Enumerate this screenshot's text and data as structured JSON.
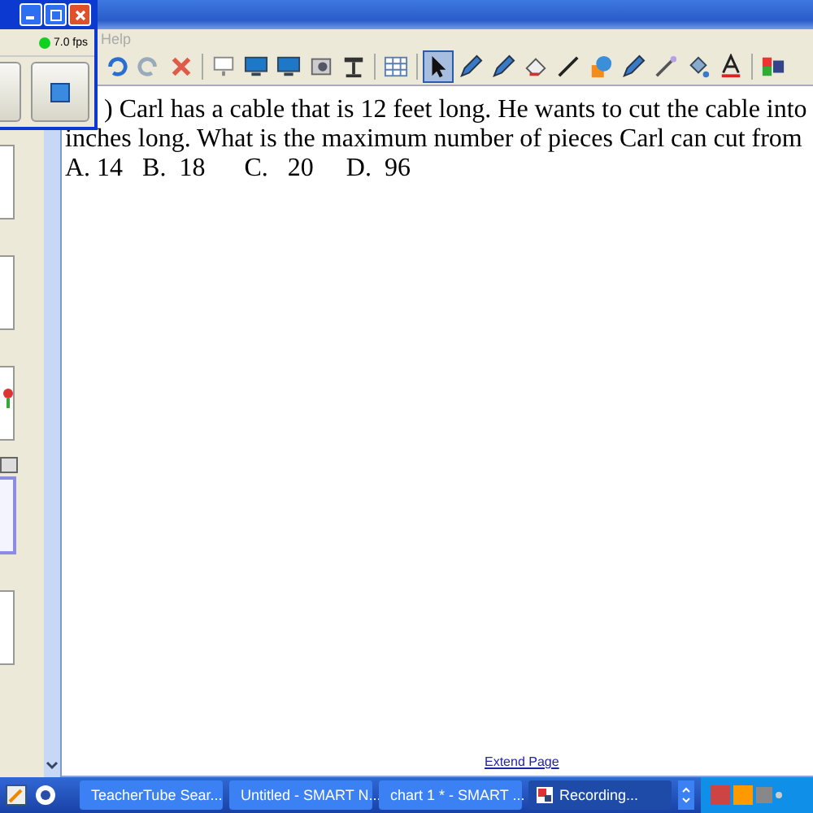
{
  "recorder": {
    "fps": "7.0 fps",
    "recording": true
  },
  "menu": [
    "Help"
  ],
  "toolbar": [
    {
      "kind": "undo",
      "selected": false
    },
    {
      "kind": "redo",
      "selected": false
    },
    {
      "kind": "delete",
      "selected": false,
      "sep_after": true
    },
    {
      "kind": "shade",
      "selected": false
    },
    {
      "kind": "monitor",
      "selected": false
    },
    {
      "kind": "monitor",
      "selected": false
    },
    {
      "kind": "camera",
      "selected": false
    },
    {
      "kind": "doccam",
      "selected": false,
      "sep_after": true
    },
    {
      "kind": "table",
      "selected": false,
      "sep_after": true
    },
    {
      "kind": "select",
      "selected": true
    },
    {
      "kind": "pen",
      "selected": false
    },
    {
      "kind": "pen",
      "selected": false
    },
    {
      "kind": "eraser",
      "selected": false
    },
    {
      "kind": "line",
      "selected": false
    },
    {
      "kind": "shapes",
      "selected": false
    },
    {
      "kind": "pen",
      "selected": false
    },
    {
      "kind": "wand",
      "selected": false
    },
    {
      "kind": "fill",
      "selected": false
    },
    {
      "kind": "text",
      "selected": false,
      "sep_after": true
    },
    {
      "kind": "more",
      "selected": false
    }
  ],
  "pages": [
    {
      "selected": false,
      "kind": "blank"
    },
    {
      "selected": false,
      "kind": "blank"
    },
    {
      "selected": false,
      "kind": "flower"
    },
    {
      "selected": true,
      "kind": "blank"
    },
    {
      "selected": false,
      "kind": "blank"
    }
  ],
  "question": {
    "lines": [
      ") Carl has a cable that is 12 feet long. He wants to cut the cable into",
      "inches long. What is the maximum number of pieces Carl can cut from",
      "A. 14   B.  18      C.   20     D.  96"
    ]
  },
  "extend_link": "Extend Page",
  "taskbar": {
    "items": [
      {
        "label": "TeacherTube Sear...",
        "kind": "browser",
        "selected": false
      },
      {
        "label": "Untitled - SMART N...",
        "kind": "notebook",
        "selected": false
      },
      {
        "label": "chart 1 * - SMART ...",
        "kind": "notebook",
        "selected": false
      },
      {
        "label": "Recording...",
        "kind": "recorder",
        "selected": true
      }
    ]
  }
}
